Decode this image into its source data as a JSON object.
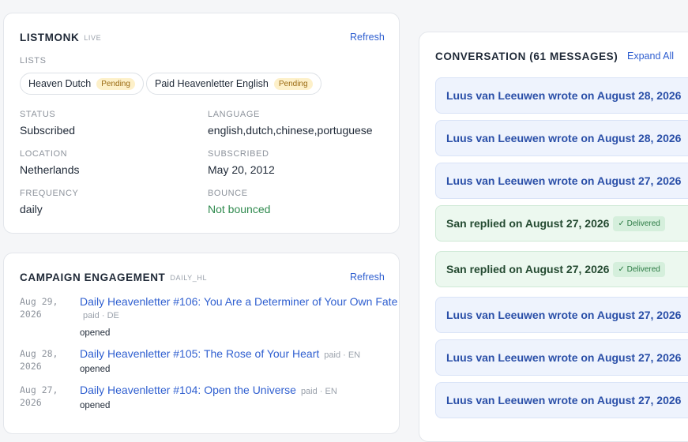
{
  "listmonk": {
    "title": "LISTMONK",
    "tag": "LIVE",
    "refresh_label": "Refresh",
    "lists_label": "LISTS",
    "lists": [
      {
        "name": "Heaven Dutch",
        "badge": "Pending"
      },
      {
        "name": "Paid Heavenletter English",
        "badge": "Pending"
      }
    ],
    "fields": {
      "status": {
        "label": "STATUS",
        "value": "Subscribed"
      },
      "language": {
        "label": "LANGUAGE",
        "value": "english,dutch,chinese,portuguese"
      },
      "location": {
        "label": "LOCATION",
        "value": "Netherlands"
      },
      "subscribed": {
        "label": "SUBSCRIBED",
        "value": "May 20, 2012"
      },
      "frequency": {
        "label": "FREQUENCY",
        "value": "daily"
      },
      "bounce": {
        "label": "BOUNCE",
        "value": "Not bounced"
      }
    }
  },
  "engagement": {
    "title": "CAMPAIGN ENGAGEMENT",
    "tag": "DAILY_HL",
    "refresh_label": "Refresh",
    "rows": [
      {
        "date_line1": "Aug 29,",
        "date_line2": "2026",
        "title": "Daily Heavenletter #106: You Are a Determiner of Your Own Fate",
        "meta": "paid · DE",
        "status": "opened"
      },
      {
        "date_line1": "Aug 28,",
        "date_line2": "2026",
        "title": "Daily Heavenletter #105: The Rose of Your Heart",
        "meta": "paid · EN",
        "status": "opened"
      },
      {
        "date_line1": "Aug 27,",
        "date_line2": "2026",
        "title": "Daily Heavenletter #104: Open the Universe",
        "meta": "paid · EN",
        "status": "opened"
      }
    ]
  },
  "conversation": {
    "title": "CONVERSATION (61 MESSAGES)",
    "expand_label": "Expand All",
    "messages": [
      {
        "type": "incoming",
        "text": "Luus van Leeuwen wrote on August 28, 2026"
      },
      {
        "type": "incoming",
        "text": "Luus van Leeuwen wrote on August 28, 2026"
      },
      {
        "type": "incoming",
        "text": "Luus van Leeuwen wrote on August 27, 2026"
      },
      {
        "type": "reply",
        "text": "San replied on August 27, 2026",
        "badge": "✓ Delivered"
      },
      {
        "type": "reply",
        "text": "San replied on August 27, 2026",
        "badge": "✓ Delivered"
      },
      {
        "type": "incoming",
        "text": "Luus van Leeuwen wrote on August 27, 2026"
      },
      {
        "type": "incoming",
        "text": "Luus van Leeuwen wrote on August 27, 2026"
      },
      {
        "type": "incoming",
        "text": "Luus van Leeuwen wrote on August 27, 2026"
      }
    ]
  },
  "colors": {
    "link": "#2f5fd0",
    "pending_bg": "#fdf0c9",
    "delivered_bg": "#d5efdc",
    "incoming_bg": "#eef3fd",
    "reply_bg": "#ecf8ef",
    "bounce_ok": "#2f8a4e"
  }
}
